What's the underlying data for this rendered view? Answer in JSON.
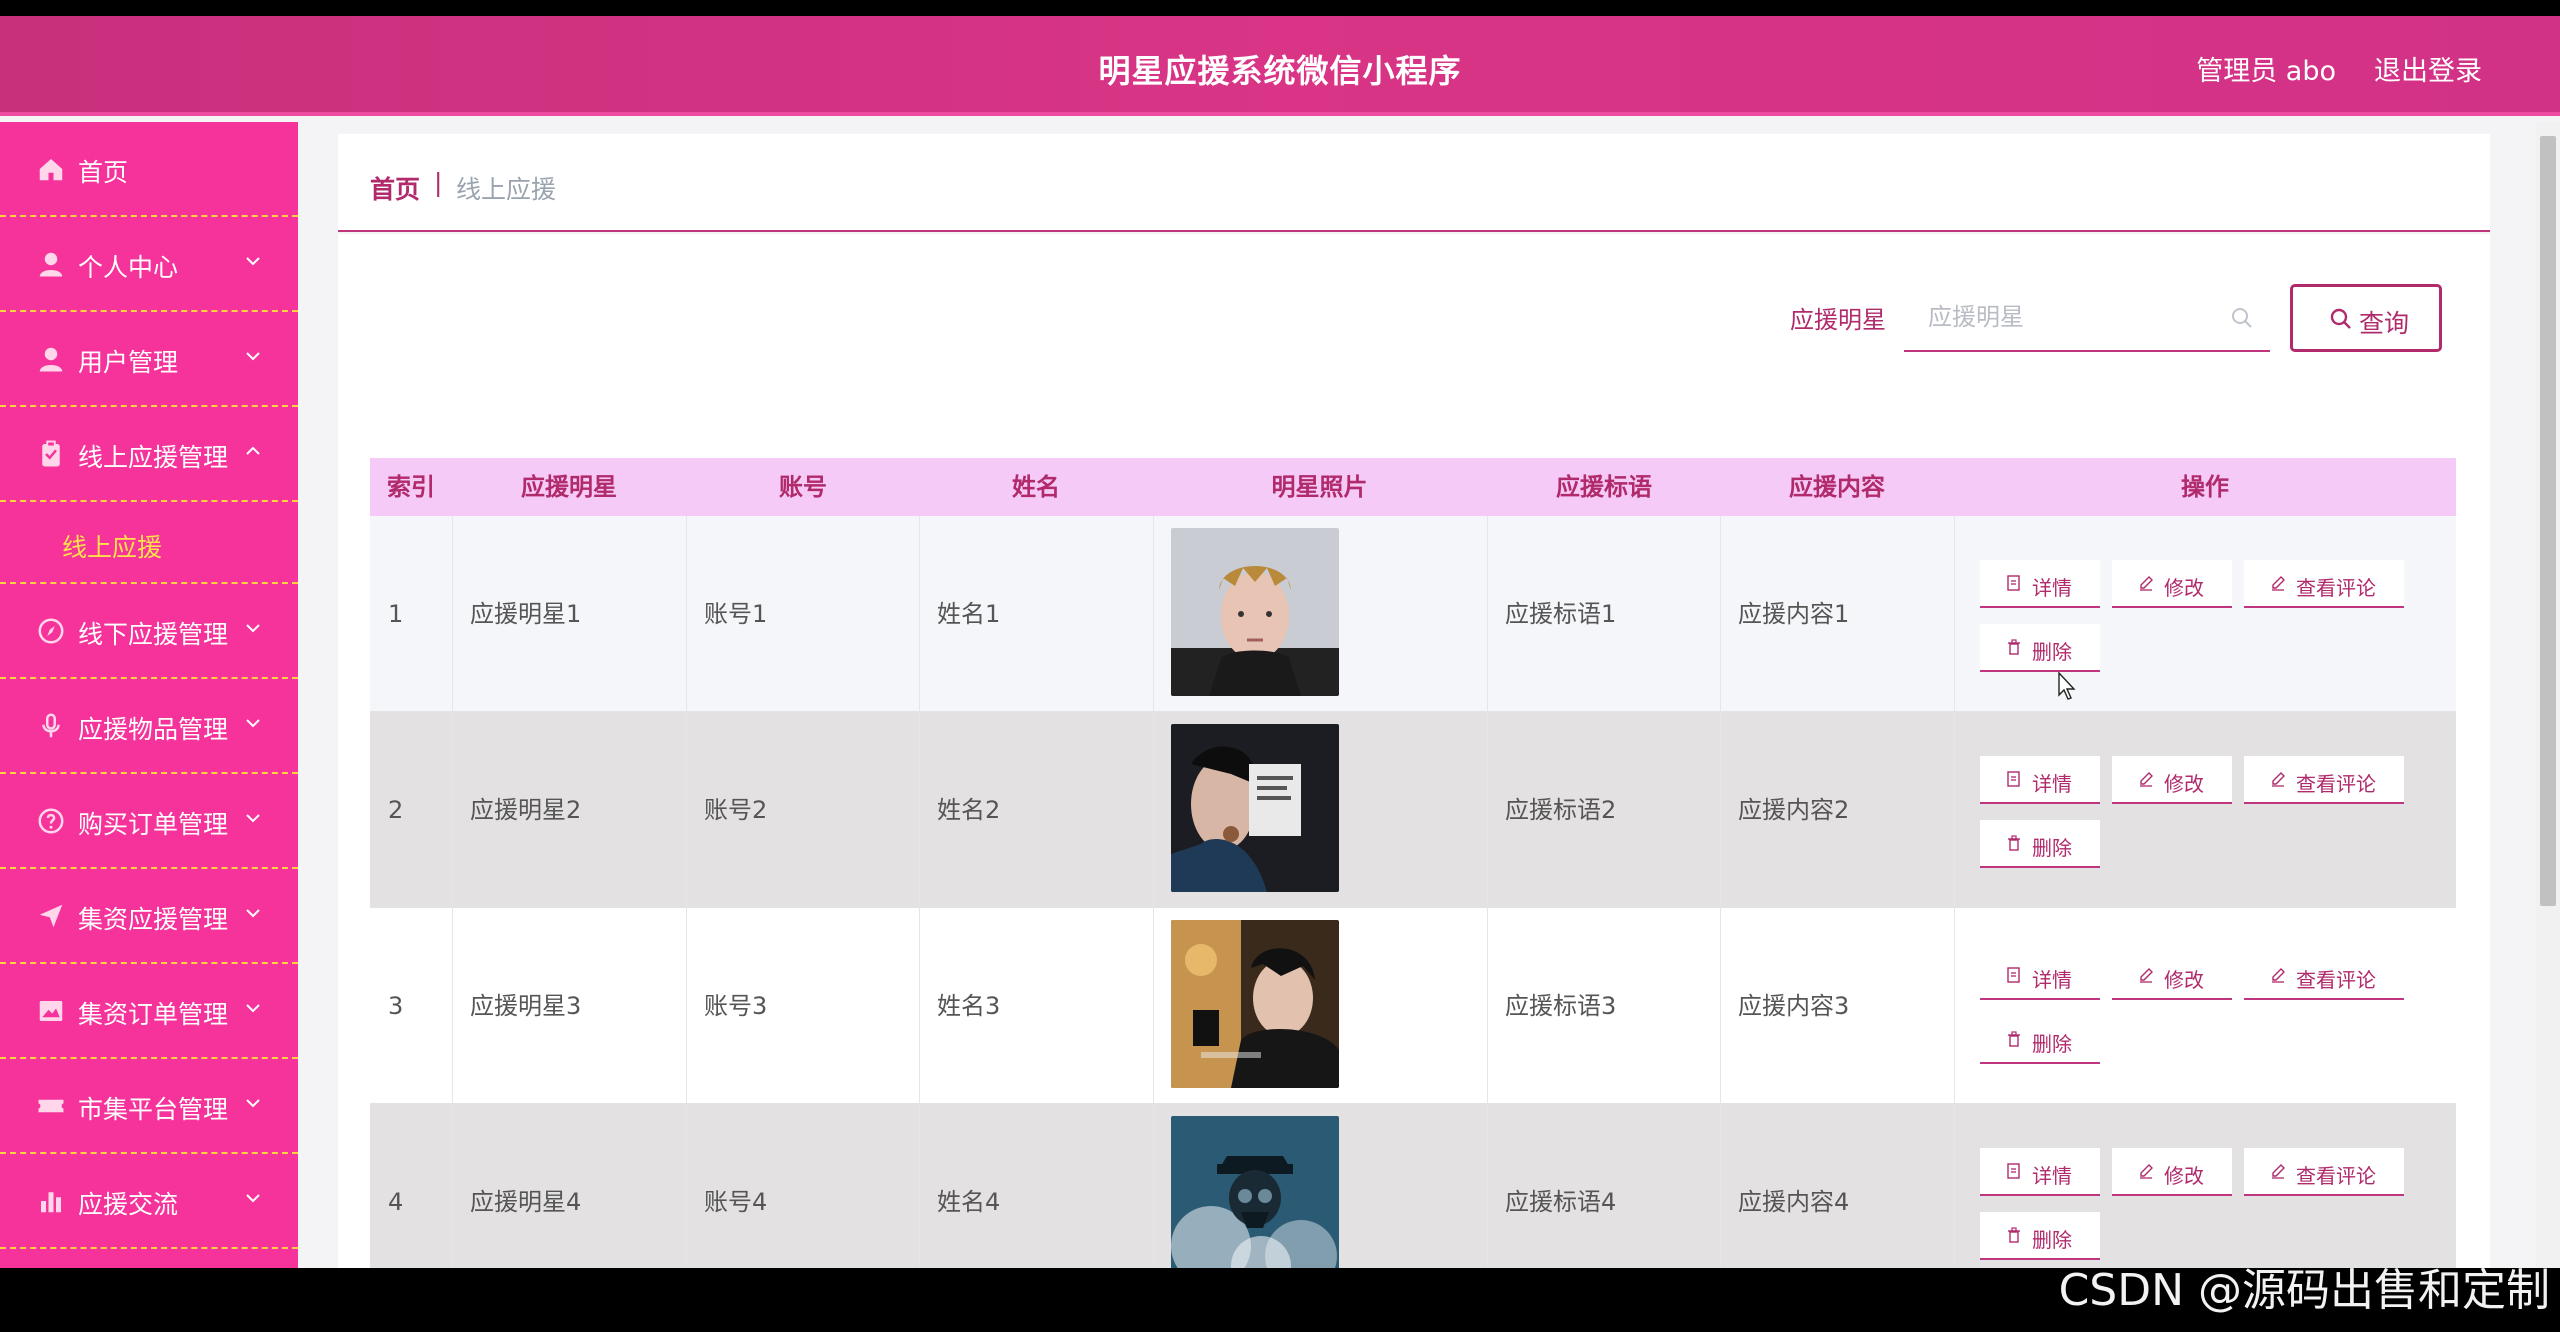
{
  "header": {
    "title": "明星应援系统微信小程序",
    "admin": "管理员 abo",
    "logout": "退出登录"
  },
  "sidebar": {
    "items": [
      {
        "label": "首页",
        "icon": "home-icon",
        "arrow": ""
      },
      {
        "label": "个人中心",
        "icon": "user-icon",
        "arrow": "down"
      },
      {
        "label": "用户管理",
        "icon": "user-icon",
        "arrow": "down"
      },
      {
        "label": "线上应援管理",
        "icon": "clipboard-icon",
        "arrow": "up"
      },
      {
        "label": "线上应援",
        "icon": "",
        "arrow": "",
        "sub": true
      },
      {
        "label": "线下应援管理",
        "icon": "compass-icon",
        "arrow": "down"
      },
      {
        "label": "应援物品管理",
        "icon": "microphone-icon",
        "arrow": "down"
      },
      {
        "label": "购买订单管理",
        "icon": "question-icon",
        "arrow": "down"
      },
      {
        "label": "集资应援管理",
        "icon": "send-icon",
        "arrow": "down"
      },
      {
        "label": "集资订单管理",
        "icon": "picture-icon",
        "arrow": "down"
      },
      {
        "label": "市集平台管理",
        "icon": "ticket-icon",
        "arrow": "down"
      },
      {
        "label": "应援交流",
        "icon": "bar-chart-icon",
        "arrow": "down"
      }
    ]
  },
  "breadcrumb": {
    "home": "首页",
    "separator": "|",
    "current": "线上应援"
  },
  "search": {
    "label": "应援明星",
    "placeholder": "应援明星",
    "button": "查询"
  },
  "table": {
    "headers": [
      "索引",
      "应援明星",
      "账号",
      "姓名",
      "明星照片",
      "应援标语",
      "应援内容",
      "操作"
    ],
    "rows": [
      {
        "index": "1",
        "star": "应援明星1",
        "account": "账号1",
        "name": "姓名1",
        "slogan": "应援标语1",
        "content": "应援内容1"
      },
      {
        "index": "2",
        "star": "应援明星2",
        "account": "账号2",
        "name": "姓名2",
        "slogan": "应援标语2",
        "content": "应援内容2"
      },
      {
        "index": "3",
        "star": "应援明星3",
        "account": "账号3",
        "name": "姓名3",
        "slogan": "应援标语3",
        "content": "应援内容3"
      },
      {
        "index": "4",
        "star": "应援明星4",
        "account": "账号4",
        "name": "姓名4",
        "slogan": "应援标语4",
        "content": "应援内容4"
      }
    ],
    "actions": {
      "detail": "详情",
      "edit": "修改",
      "comments": "查看评论",
      "delete": "删除"
    }
  },
  "watermark": "CSDN @源码出售和定制",
  "colors": {
    "header": "#d93486",
    "sidebar": "#f5339a",
    "accent": "#b02a6c",
    "table_header": "#f6caf6",
    "sidebar_divider": "#ffd23f"
  }
}
